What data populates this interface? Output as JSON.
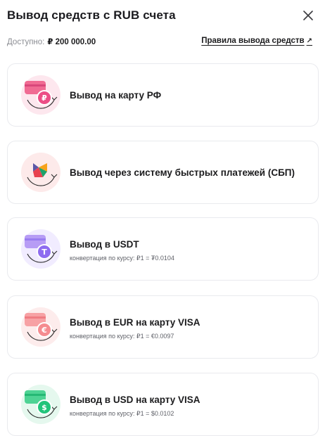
{
  "header": {
    "title": "Вывод средств с RUB счета",
    "close_icon": "close-icon"
  },
  "balance": {
    "label": "Доступно:",
    "value": "₽ 200 000.00",
    "rules_link": "Правила вывода средств",
    "rules_arrow": "↗"
  },
  "options": [
    {
      "label": "Вывод на карту РФ",
      "icon": "rub-card-icon",
      "accent": "#f04e7a"
    },
    {
      "label": "Вывод через систему быстрых платежей (СБП)",
      "icon": "sbp-icon",
      "accent": "#e8424f"
    },
    {
      "label": "Вывод в USDT",
      "sub": "конвертация по курсу: ₽1 = ₮0.0104",
      "icon": "usdt-card-icon",
      "accent": "#9a7cf0"
    },
    {
      "label": "Вывод в EUR на карту VISA",
      "sub": "конвертация по курсу: ₽1 = €0.0097",
      "icon": "eur-card-icon",
      "accent": "#f07a82"
    },
    {
      "label": "Вывод в USD на карту VISA",
      "sub": "конвертация по курсу: ₽1 = $0.0102",
      "icon": "usd-card-icon",
      "accent": "#22c47a"
    }
  ]
}
